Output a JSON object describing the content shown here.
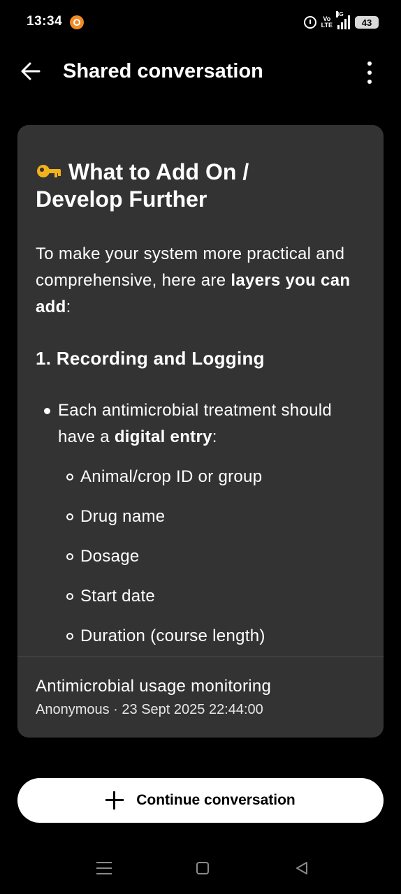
{
  "status_bar": {
    "time": "13:34",
    "volte_line1": "Vo",
    "volte_line2": "LTE",
    "network": "4G",
    "battery": "43",
    "icons": [
      "app-notification-icon",
      "alarm-icon",
      "volte-icon",
      "signal-icon",
      "battery-icon"
    ]
  },
  "app_bar": {
    "title": "Shared conversation",
    "back_icon": "arrow-left",
    "menu_icon": "more-vertical"
  },
  "message": {
    "heading_line1": "What to Add On /",
    "heading_line2": "Develop Further",
    "heading_icon": "key-emoji",
    "intro_text": "To make your system more practical and comprehensive, here are ",
    "intro_bold": "layers you can add",
    "intro_end": ":",
    "section_title": "1. Recording and Logging",
    "bullet_text": "Each antimicrobial treatment should have a ",
    "bullet_bold": "digital entry",
    "bullet_end": ":",
    "sub_items": [
      "Animal/crop ID or group",
      "Drug name",
      "Dosage",
      "Start date",
      "Duration (course length)"
    ]
  },
  "conversation": {
    "title": "Antimicrobial usage monitoring",
    "meta": "Anonymous · 23 Sept 2025 22:44:00"
  },
  "continue_button": {
    "label": "Continue conversation"
  },
  "colors": {
    "background": "#000000",
    "card": "#333333",
    "button": "#ffffff"
  }
}
